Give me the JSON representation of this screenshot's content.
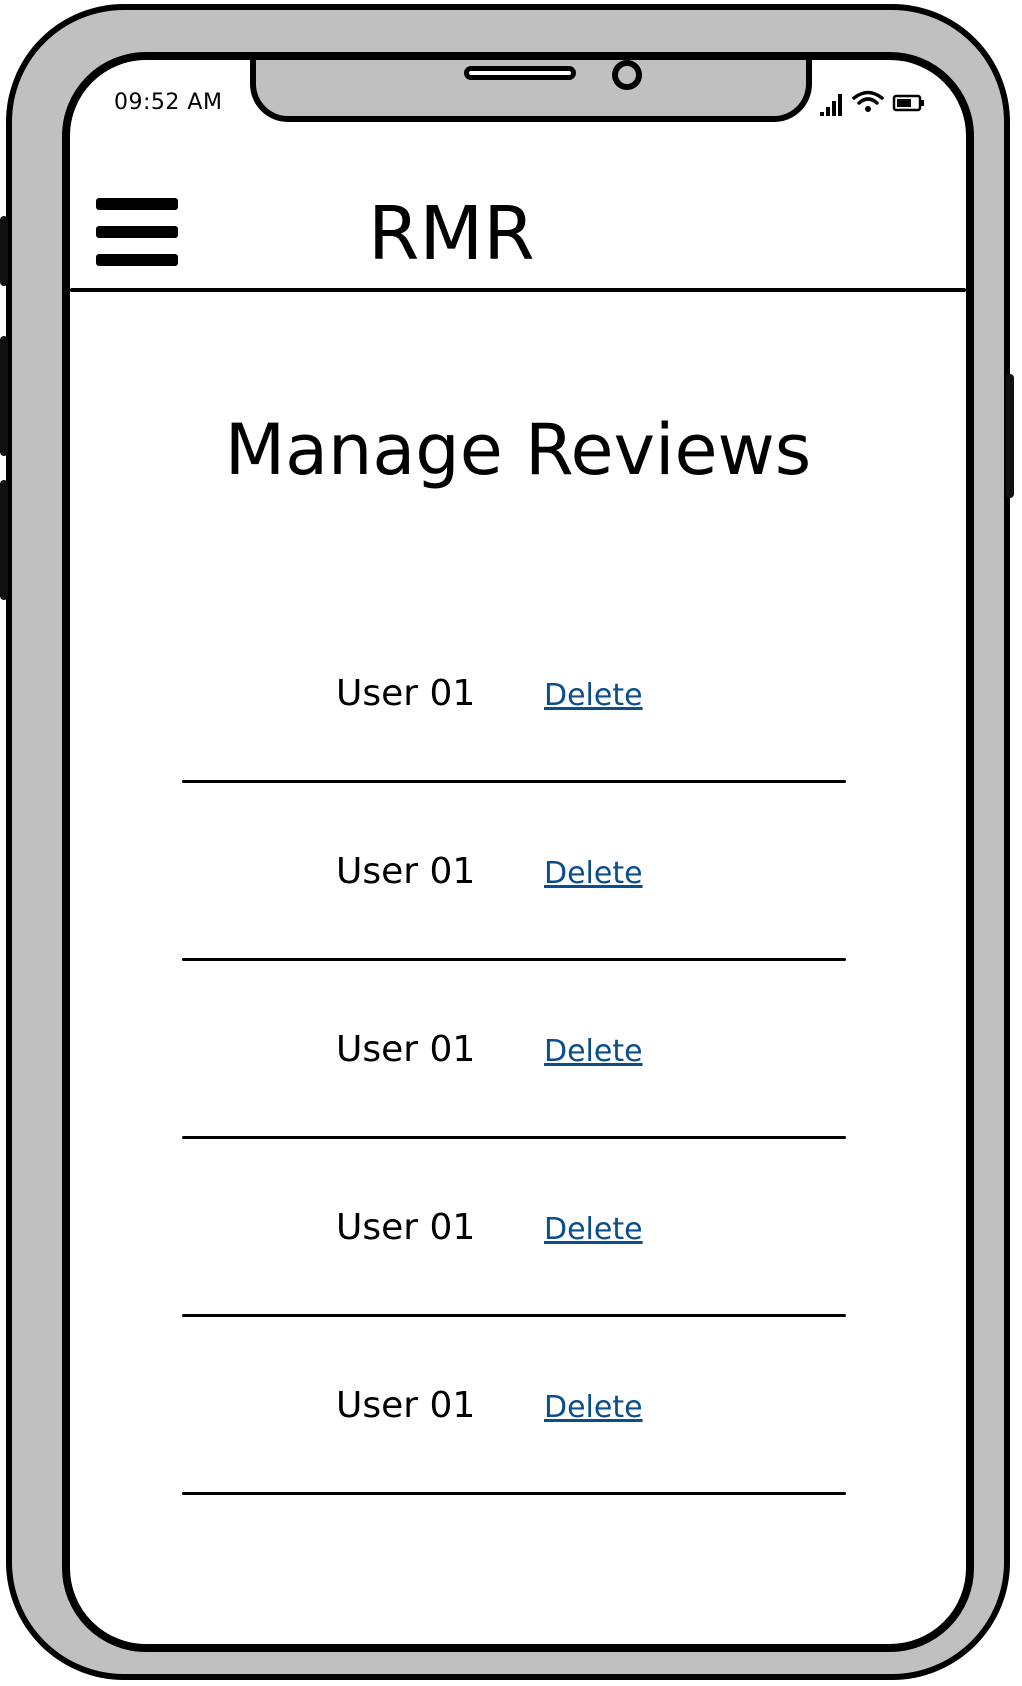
{
  "status_bar": {
    "time": "09:52 AM",
    "icons": [
      "signal-icon",
      "wifi-icon",
      "battery-icon"
    ]
  },
  "header": {
    "menu_icon": "hamburger-menu-icon",
    "app_title": "RMR"
  },
  "main": {
    "page_title": "Manage Reviews",
    "reviews": [
      {
        "user": "User 01",
        "action": "Delete"
      },
      {
        "user": "User 01",
        "action": "Delete"
      },
      {
        "user": "User 01",
        "action": "Delete"
      },
      {
        "user": "User 01",
        "action": "Delete"
      },
      {
        "user": "User 01",
        "action": "Delete"
      }
    ]
  },
  "colors": {
    "link": "#0b4e8e",
    "frame": "#c0c0c0",
    "ink": "#000000"
  }
}
